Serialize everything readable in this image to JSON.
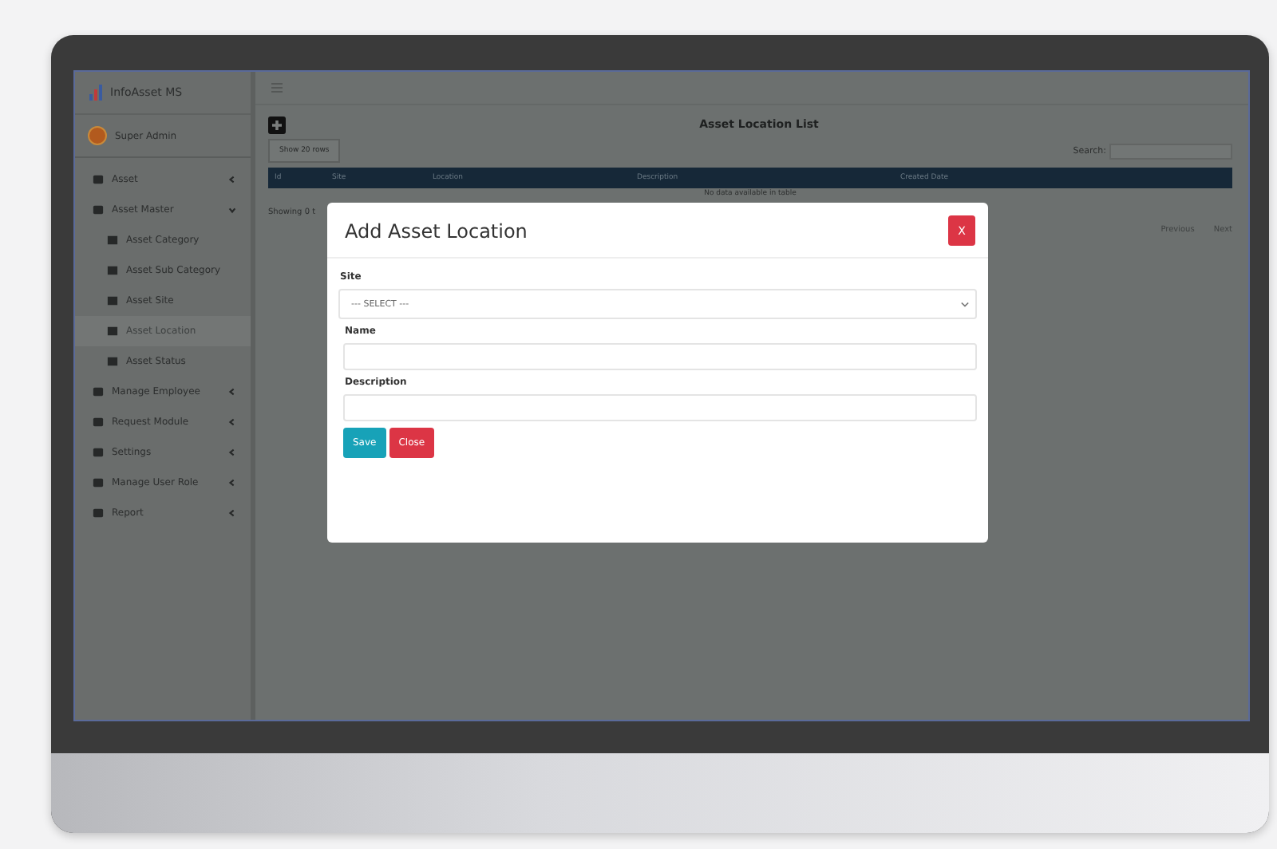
{
  "brand": {
    "name": "InfoAsset MS"
  },
  "user": {
    "name": "Super Admin"
  },
  "sidebar": {
    "items": [
      {
        "label": "Asset",
        "expanded": false,
        "selected": false
      },
      {
        "label": "Asset Master",
        "expanded": true,
        "selected": false,
        "children": [
          {
            "label": "Asset Category",
            "selected": false
          },
          {
            "label": "Asset Sub Category",
            "selected": false
          },
          {
            "label": "Asset Site",
            "selected": false
          },
          {
            "label": "Asset Location",
            "selected": true
          },
          {
            "label": "Asset Status",
            "selected": false
          }
        ]
      },
      {
        "label": "Manage Employee",
        "expanded": false,
        "selected": false
      },
      {
        "label": "Request Module",
        "expanded": false,
        "selected": false
      },
      {
        "label": "Settings",
        "expanded": false,
        "selected": false
      },
      {
        "label": "Manage User Role",
        "expanded": false,
        "selected": false
      },
      {
        "label": "Report",
        "expanded": false,
        "selected": false
      }
    ]
  },
  "page": {
    "title": "Asset Location List",
    "rows_button": "Show 20 rows",
    "search_label": "Search:"
  },
  "table": {
    "columns": [
      "Id",
      "Site",
      "Location",
      "Description",
      "Created Date"
    ],
    "empty_message": "No data available in table"
  },
  "footer": {
    "info": "Showing 0 t",
    "previous": "Previous",
    "next": "Next"
  },
  "modal": {
    "title": "Add Asset Location",
    "close_x": "X",
    "fields": [
      {
        "label": "Site",
        "kind": "select",
        "value": "--- SELECT ---"
      },
      {
        "label": "Name",
        "kind": "text"
      },
      {
        "label": "Description",
        "kind": "text"
      }
    ],
    "buttons": [
      {
        "label": "Save",
        "kind": "primary"
      },
      {
        "label": "Close",
        "kind": "danger"
      }
    ]
  }
}
